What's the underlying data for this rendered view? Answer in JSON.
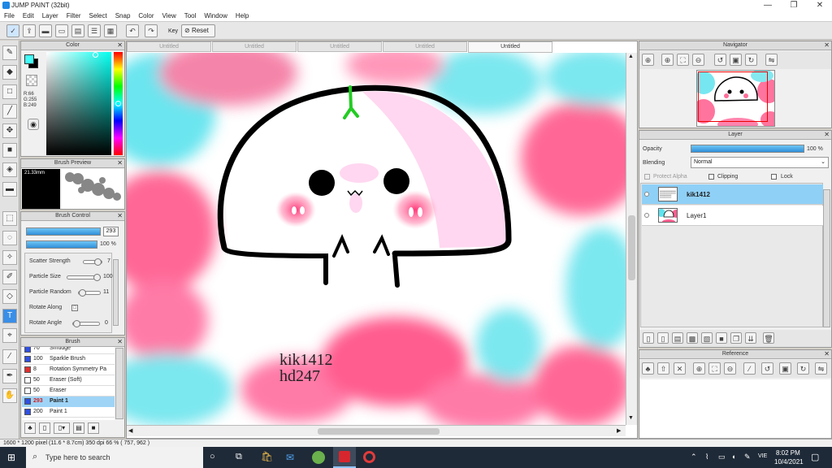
{
  "app": {
    "title": "JUMP PAINT (32bit)"
  },
  "window": {
    "min": "—",
    "max": "❐",
    "close": "✕"
  },
  "menu": [
    "File",
    "Edit",
    "Layer",
    "Filter",
    "Select",
    "Snap",
    "Color",
    "View",
    "Tool",
    "Window",
    "Help"
  ],
  "toolbar": {
    "key_label": "Key",
    "reset_label": "Reset"
  },
  "color_panel": {
    "title": "Color",
    "r": "R:66",
    "g": "G:255",
    "b": "B:249",
    "fg": "#42fff9"
  },
  "brush_preview": {
    "title": "Brush Preview",
    "size": "21.33mm"
  },
  "brush_control": {
    "title": "Brush Control",
    "size_value": "293",
    "opacity_value": "100 %",
    "params": [
      {
        "label": "Scatter Strength",
        "value": "7"
      },
      {
        "label": "Particle Size",
        "value": "100"
      },
      {
        "label": "Particle Random",
        "value": "11"
      },
      {
        "label": "Rotate Along",
        "value": ""
      },
      {
        "label": "Rotate Angle",
        "value": "0"
      }
    ]
  },
  "brush": {
    "title": "Brush",
    "items": [
      {
        "size": "70",
        "name": "Smudge",
        "color": "#3050e0"
      },
      {
        "size": "100",
        "name": "Sparkle Brush",
        "color": "#3050e0"
      },
      {
        "size": "8",
        "name": "Rotation Symmetry Pa",
        "color": "#e03030"
      },
      {
        "size": "50",
        "name": "Eraser (Soft)",
        "color": "#ffffff"
      },
      {
        "size": "50",
        "name": "Eraser",
        "color": "#ffffff"
      },
      {
        "size": "293",
        "name": "Paint 1",
        "color": "#3050e0"
      },
      {
        "size": "200",
        "name": "Paint 1",
        "color": "#3050e0"
      }
    ]
  },
  "tabs": [
    "Untitled",
    "Untitled",
    "Untitled",
    "Untitled",
    "Untitled"
  ],
  "canvas_text": {
    "line1": "kik1412",
    "line2": "hd247"
  },
  "navigator": {
    "title": "Navigator"
  },
  "layer": {
    "title": "Layer",
    "opacity_label": "Opacity",
    "opacity_value": "100 %",
    "blending_label": "Blending",
    "blending_value": "Normal",
    "protect_alpha": "Protect Alpha",
    "clipping": "Clipping",
    "lock": "Lock",
    "layers": [
      {
        "name": "kik1412",
        "selected": true
      },
      {
        "name": "Layer1",
        "selected": false
      }
    ]
  },
  "reference": {
    "title": "Reference"
  },
  "status": {
    "text": "1600 * 1200 pixel  (11.6 * 8.7cm)  350 dpi  66 %  ( 757, 962 )"
  },
  "taskbar": {
    "search_placeholder": "Type here to search",
    "lang": "VIE",
    "time": "8:02 PM",
    "date": "10/4/2021"
  }
}
